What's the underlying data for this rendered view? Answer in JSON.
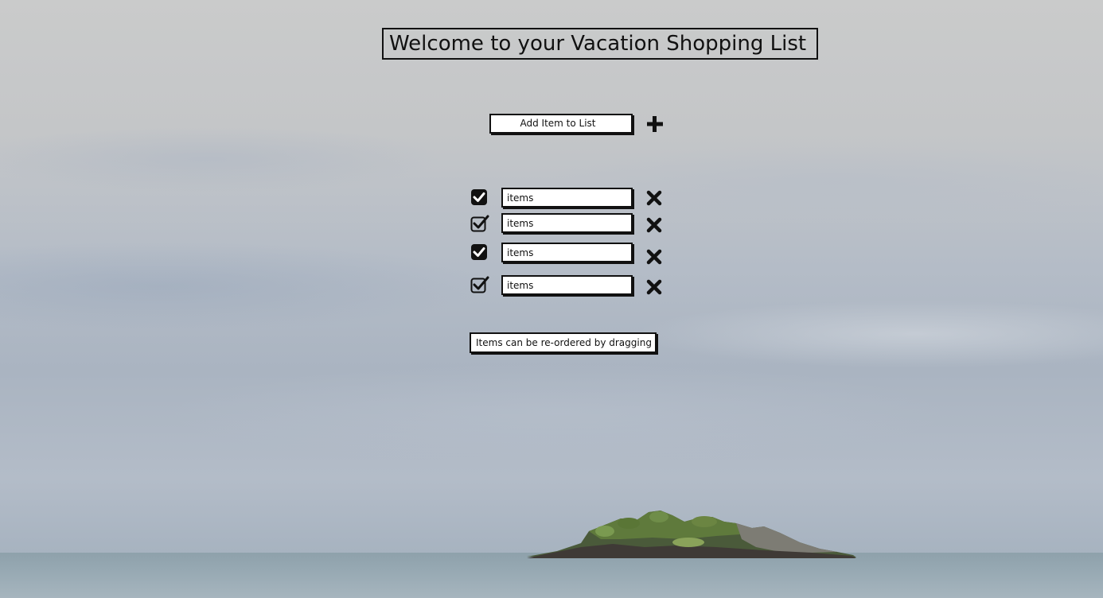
{
  "title": "Welcome to your Vacation Shopping List",
  "add_button": {
    "label": "Add Item to List",
    "icon": "plus-icon"
  },
  "items": [
    {
      "value": "items",
      "checked": true,
      "checkbox_style": "filled",
      "remove_icon": "close-icon"
    },
    {
      "value": "items",
      "checked": true,
      "checkbox_style": "outline",
      "remove_icon": "close-icon"
    },
    {
      "value": "items",
      "checked": true,
      "checkbox_style": "filled",
      "remove_icon": "close-icon"
    },
    {
      "value": "items",
      "checked": true,
      "checkbox_style": "outline",
      "remove_icon": "close-icon"
    }
  ],
  "note": "Items can be re-ordered by dragging",
  "colors": {
    "sky": "#c4c6c8",
    "sea": "#97a9b3",
    "ink": "#111111",
    "box": "#ffffff"
  }
}
